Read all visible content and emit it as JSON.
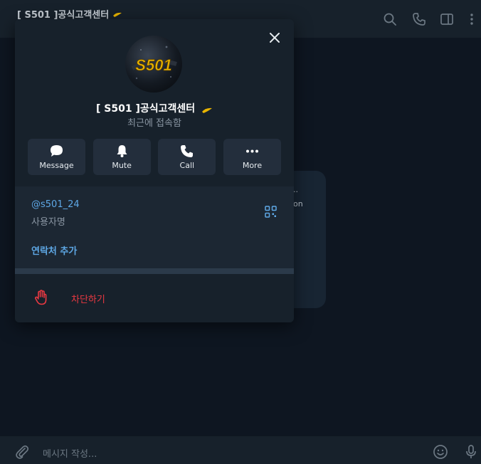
{
  "window": {
    "title": "[ S501 ]공식고객센터",
    "title_suffix_icon": "ribbon-icon"
  },
  "toolbar_icons": [
    "search-icon",
    "phone-icon",
    "sidebar-icon",
    "more-vert-icon"
  ],
  "background_bubble": {
    "visible_fragments": [
      "..",
      "on"
    ]
  },
  "composer": {
    "placeholder": "메시지 작성...",
    "left_icon": "paperclip-icon",
    "right_icons": [
      "emoji-icon",
      "microphone-icon"
    ]
  },
  "profile": {
    "avatar_logo_text": "S501",
    "name": "[ S501 ]공식고객센터",
    "name_suffix_icon": "ribbon-icon",
    "status": "최근에 접속함",
    "actions": [
      {
        "label": "Message",
        "icon": "chat-bubble-icon"
      },
      {
        "label": "Mute",
        "icon": "bell-icon"
      },
      {
        "label": "Call",
        "icon": "phone-icon"
      },
      {
        "label": "More",
        "icon": "dots-icon"
      }
    ],
    "username": "@s501_24",
    "username_caption": "사용자명",
    "add_contact": "연락처 추가",
    "block": "차단하기",
    "close_icon": "close-icon"
  },
  "colors": {
    "accent": "#5ea8e6",
    "danger": "#ec3942",
    "panel": "#17212b",
    "background": "#0e1621"
  }
}
